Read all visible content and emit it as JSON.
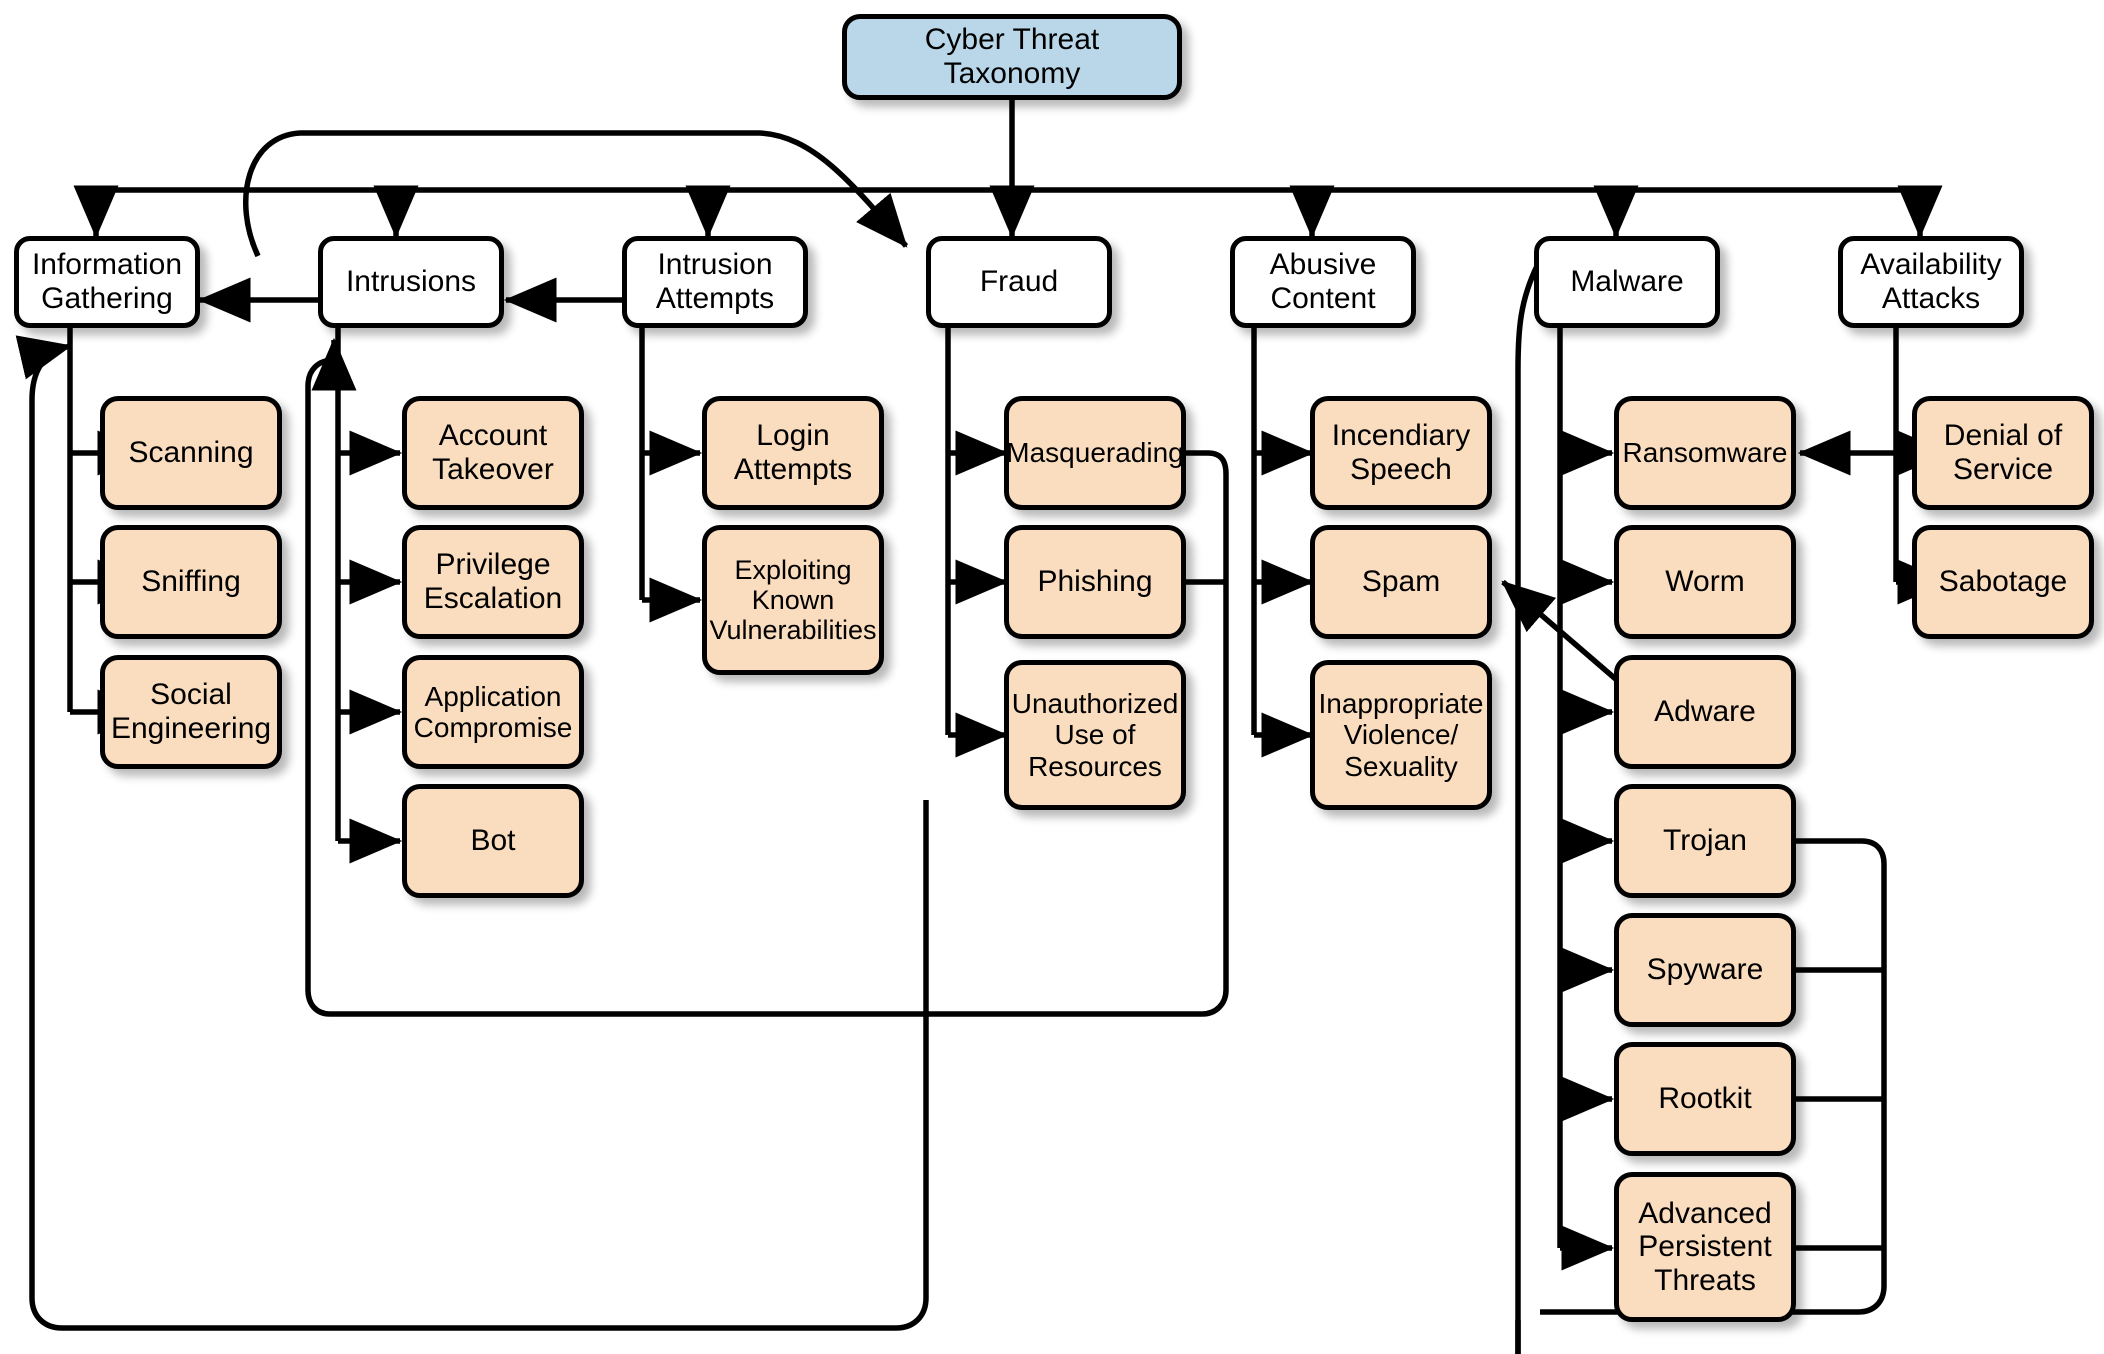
{
  "diagram": {
    "title": "Cyber Threat Taxonomy",
    "type": "taxonomy-tree",
    "colors": {
      "root_fill": "#b9d7e8",
      "category_fill": "#ffffff",
      "leaf_fill": "#fadcbe",
      "stroke": "#000000",
      "background": "#ffffff"
    },
    "root": {
      "label": "Cyber Threat Taxonomy"
    },
    "categories": [
      {
        "label": "Information Gathering",
        "children": [
          "Scanning",
          "Sniffing",
          "Social Engineering"
        ]
      },
      {
        "label": "Intrusions",
        "children": [
          "Account Takeover",
          "Privilege Escalation",
          "Application Compromise",
          "Bot"
        ]
      },
      {
        "label": "Intrusion Attempts",
        "children": [
          "Login Attempts",
          "Exploiting Known Vulnerabilities"
        ]
      },
      {
        "label": "Fraud",
        "children": [
          "Masquerading",
          "Phishing",
          "Unauthorized Use of Resources"
        ]
      },
      {
        "label": "Abusive Content",
        "children": [
          "Incendiary Speech",
          "Spam",
          "Inappropriate Violence/ Sexuality"
        ]
      },
      {
        "label": "Malware",
        "children": [
          "Ransomware",
          "Worm",
          "Adware",
          "Trojan",
          "Spyware",
          "Rootkit",
          "Advanced Persistent Threats"
        ]
      },
      {
        "label": "Availability Attacks",
        "children": [
          "Denial of Service",
          "Sabotage"
        ]
      }
    ],
    "nodes": {
      "root": "Cyber Threat Taxonomy",
      "cat_info": "Information\nGathering",
      "cat_intrusions": "Intrusions",
      "cat_intrusion_attempts": "Intrusion\nAttempts",
      "cat_fraud": "Fraud",
      "cat_abusive": "Abusive\nContent",
      "cat_malware": "Malware",
      "cat_availability": "Availability\nAttacks",
      "leaf_scanning": "Scanning",
      "leaf_sniffing": "Sniffing",
      "leaf_social": "Social\nEngineering",
      "leaf_account_takeover": "Account\nTakeover",
      "leaf_priv_esc": "Privilege\nEscalation",
      "leaf_app_compromise": "Application\nCompromise",
      "leaf_bot": "Bot",
      "leaf_login_attempts": "Login\nAttempts",
      "leaf_exploiting": "Exploiting\nKnown\nVulnerabilities",
      "leaf_masquerading": "Masquerading",
      "leaf_phishing": "Phishing",
      "leaf_unauthorized": "Unauthorized\nUse of\nResources",
      "leaf_incendiary": "Incendiary\nSpeech",
      "leaf_spam": "Spam",
      "leaf_inappropriate": "Inappropriate\nViolence/\nSexuality",
      "leaf_ransomware": "Ransomware",
      "leaf_worm": "Worm",
      "leaf_adware": "Adware",
      "leaf_trojan": "Trojan",
      "leaf_spyware": "Spyware",
      "leaf_rootkit": "Rootkit",
      "leaf_apt": "Advanced\nPersistent\nThreats",
      "leaf_dos": "Denial of\nService",
      "leaf_sabotage": "Sabotage"
    },
    "cross_links": [
      {
        "from": "Intrusions",
        "to": "Information Gathering"
      },
      {
        "from": "Intrusion Attempts",
        "to": "Intrusions"
      },
      {
        "from": "Denial of Service",
        "to": "Ransomware"
      },
      {
        "from": "Adware",
        "to": "Spam"
      }
    ]
  }
}
